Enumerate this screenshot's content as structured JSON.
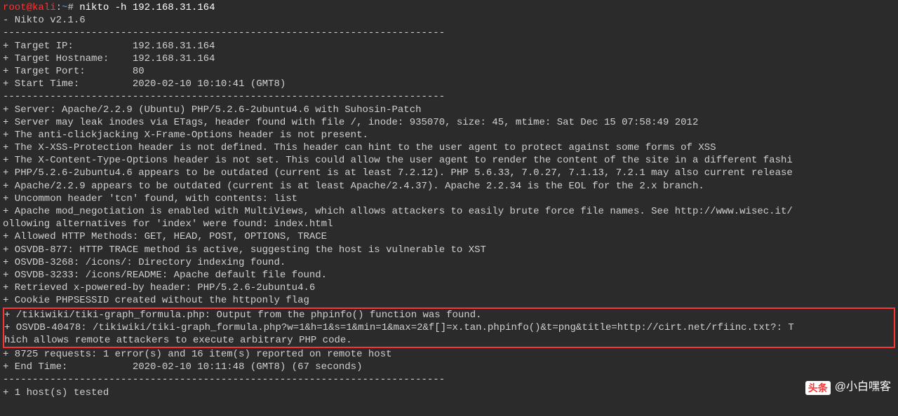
{
  "prompt": {
    "user": "root@kali",
    "sep1": ":",
    "path": "~",
    "sep2": "# ",
    "command": "nikto -h 192.168.31.164"
  },
  "version_line": "- Nikto v2.1.6",
  "divider": "---------------------------------------------------------------------------",
  "target": {
    "ip": "+ Target IP:          192.168.31.164",
    "hostname": "+ Target Hostname:    192.168.31.164",
    "port": "+ Target Port:        80",
    "start": "+ Start Time:         2020-02-10 10:10:41 (GMT8)"
  },
  "findings": [
    "+ Server: Apache/2.2.9 (Ubuntu) PHP/5.2.6-2ubuntu4.6 with Suhosin-Patch",
    "+ Server may leak inodes via ETags, header found with file /, inode: 935070, size: 45, mtime: Sat Dec 15 07:58:49 2012",
    "+ The anti-clickjacking X-Frame-Options header is not present.",
    "+ The X-XSS-Protection header is not defined. This header can hint to the user agent to protect against some forms of XSS",
    "+ The X-Content-Type-Options header is not set. This could allow the user agent to render the content of the site in a different fashi",
    "+ PHP/5.2.6-2ubuntu4.6 appears to be outdated (current is at least 7.2.12). PHP 5.6.33, 7.0.27, 7.1.13, 7.2.1 may also current release",
    "+ Apache/2.2.9 appears to be outdated (current is at least Apache/2.4.37). Apache 2.2.34 is the EOL for the 2.x branch.",
    "+ Uncommon header 'tcn' found, with contents: list",
    "+ Apache mod_negotiation is enabled with MultiViews, which allows attackers to easily brute force file names. See http://www.wisec.it/",
    "ollowing alternatives for 'index' were found: index.html",
    "+ Allowed HTTP Methods: GET, HEAD, POST, OPTIONS, TRACE ",
    "+ OSVDB-877: HTTP TRACE method is active, suggesting the host is vulnerable to XST",
    "+ OSVDB-3268: /icons/: Directory indexing found.",
    "+ OSVDB-3233: /icons/README: Apache default file found.",
    "+ Retrieved x-powered-by header: PHP/5.2.6-2ubuntu4.6",
    "+ Cookie PHPSESSID created without the httponly flag"
  ],
  "highlighted": [
    "+ /tikiwiki/tiki-graph_formula.php: Output from the phpinfo() function was found.",
    "+ OSVDB-40478: /tikiwiki/tiki-graph_formula.php?w=1&h=1&s=1&min=1&max=2&f[]=x.tan.phpinfo()&t=png&title=http://cirt.net/rfiinc.txt?: T",
    "hich allows remote attackers to execute arbitrary PHP code."
  ],
  "summary": {
    "requests": "+ 8725 requests: 1 error(s) and 16 item(s) reported on remote host",
    "end": "+ End Time:           2020-02-10 10:11:48 (GMT8) (67 seconds)"
  },
  "footer": "+ 1 host(s) tested",
  "watermark": {
    "logo": "头条",
    "text": "@小白嘿客"
  }
}
